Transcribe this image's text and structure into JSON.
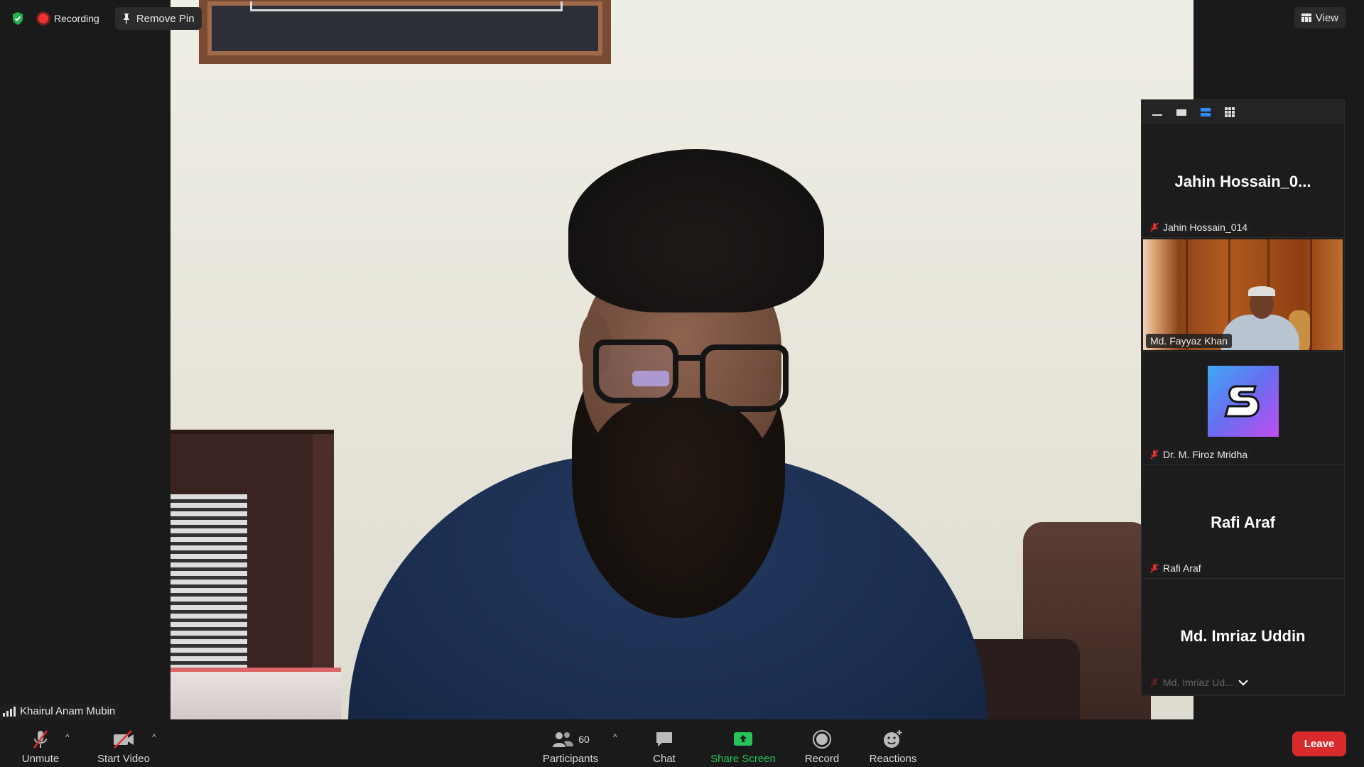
{
  "topbar": {
    "recording_label": "Recording",
    "remove_pin_label": "Remove Pin",
    "view_label": "View"
  },
  "side_panel": {
    "tiles": [
      {
        "big_name": "Jahin  Hossain_0...",
        "label": "Jahin Hossain_014",
        "muted": true
      },
      {
        "label": "Md. Fayyaz Khan",
        "muted": false
      },
      {
        "label": "Dr. M. Firoz Mridha",
        "muted": true
      },
      {
        "big_name": "Rafi Araf",
        "label": "Rafi Araf",
        "muted": true
      },
      {
        "big_name": "Md. Imriaz Uddin",
        "label": "Md. Imriaz Ud...",
        "muted": true
      }
    ]
  },
  "speaker": {
    "name": "Khairul Anam Mubin"
  },
  "toolbar": {
    "unmute_label": "Unmute",
    "start_video_label": "Start Video",
    "participants_label": "Participants",
    "participants_count": "60",
    "chat_label": "Chat",
    "share_screen_label": "Share Screen",
    "record_label": "Record",
    "reactions_label": "Reactions",
    "leave_label": "Leave"
  },
  "colors": {
    "accent_green": "#25c35a",
    "leave_red": "#d92b2b",
    "mute_red": "#e03030",
    "active_view_blue": "#2d8cff"
  }
}
